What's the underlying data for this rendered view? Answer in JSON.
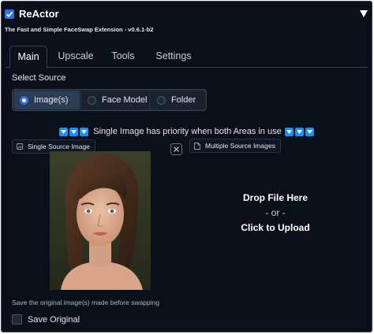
{
  "header": {
    "title": "ReActor",
    "subtitle": "The Fast and Simple FaceSwap Extension - v0.6.1-b2",
    "enabled": true
  },
  "tabs": [
    {
      "label": "Main",
      "active": true
    },
    {
      "label": "Upscale",
      "active": false
    },
    {
      "label": "Tools",
      "active": false
    },
    {
      "label": "Settings",
      "active": false
    }
  ],
  "source": {
    "label": "Select Source",
    "options": [
      {
        "label": "Image(s)",
        "selected": true
      },
      {
        "label": "Face Model",
        "selected": false
      },
      {
        "label": "Folder",
        "selected": false
      }
    ]
  },
  "priority_note": "Single Image has priority when both Areas in use",
  "single_source": {
    "label": "Single Source Image",
    "icon": "image-icon"
  },
  "multiple_source": {
    "label": "Multiple Source Images",
    "icon": "file-icon"
  },
  "dropzone": {
    "line1": "Drop File Here",
    "line2": "- or -",
    "line3": "Click to Upload"
  },
  "footer": {
    "hint": "Save the original image(s) made before swapping",
    "save_label": "Save Original",
    "save_checked": false
  },
  "colors": {
    "background": "#0b0f19",
    "accent": "#2f6fe4",
    "arrow_icon": "#1d8ff2"
  }
}
